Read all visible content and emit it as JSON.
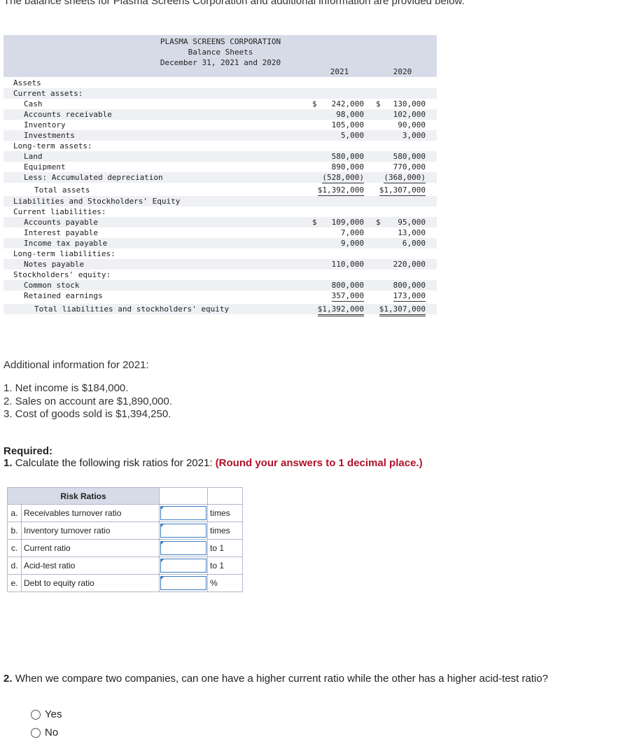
{
  "intro": "The balance sheets for Plasma Screens Corporation and additional information are provided below.",
  "balance_sheet": {
    "company": "PLASMA SCREENS CORPORATION",
    "statement": "Balance Sheets",
    "date": "December 31, 2021 and 2020",
    "years": [
      "2021",
      "2020"
    ],
    "rows": [
      {
        "label": "Assets",
        "indent": 0,
        "v1": "",
        "v2": ""
      },
      {
        "label": "Current assets:",
        "indent": 0,
        "v1": "",
        "v2": ""
      },
      {
        "label": "Cash",
        "indent": 2,
        "c1": "$",
        "v1": "242,000",
        "c2": "$",
        "v2": "130,000"
      },
      {
        "label": "Accounts receivable",
        "indent": 2,
        "v1": "98,000",
        "v2": "102,000"
      },
      {
        "label": "Inventory",
        "indent": 2,
        "v1": "105,000",
        "v2": "90,000"
      },
      {
        "label": "Investments",
        "indent": 2,
        "v1": "5,000",
        "v2": "3,000"
      },
      {
        "label": "Long-term assets:",
        "indent": 0,
        "v1": "",
        "v2": ""
      },
      {
        "label": "Land",
        "indent": 2,
        "v1": "580,000",
        "v2": "580,000"
      },
      {
        "label": "Equipment",
        "indent": 2,
        "v1": "890,000",
        "v2": "770,000"
      },
      {
        "label": "Less: Accumulated depreciation",
        "indent": 2,
        "v1": "(528,000)",
        "v2": "(368,000)",
        "line": "single"
      },
      {
        "label": "Total assets",
        "indent": 4,
        "v1": "$1,392,000",
        "v2": "$1,307,000",
        "line": "double"
      },
      {
        "label": "Liabilities and Stockholders' Equity",
        "indent": 0,
        "v1": "",
        "v2": ""
      },
      {
        "label": "Current liabilities:",
        "indent": 0,
        "v1": "",
        "v2": ""
      },
      {
        "label": "Accounts payable",
        "indent": 2,
        "c1": "$",
        "v1": "109,000",
        "c2": "$",
        "v2": "95,000"
      },
      {
        "label": "Interest payable",
        "indent": 2,
        "v1": "7,000",
        "v2": "13,000"
      },
      {
        "label": "Income tax payable",
        "indent": 2,
        "v1": "9,000",
        "v2": "6,000"
      },
      {
        "label": "Long-term liabilities:",
        "indent": 0,
        "v1": "",
        "v2": ""
      },
      {
        "label": "Notes payable",
        "indent": 2,
        "v1": "110,000",
        "v2": "220,000"
      },
      {
        "label": "Stockholders' equity:",
        "indent": 0,
        "v1": "",
        "v2": ""
      },
      {
        "label": "Common stock",
        "indent": 2,
        "v1": "800,000",
        "v2": "800,000"
      },
      {
        "label": "Retained earnings",
        "indent": 2,
        "v1": "357,000",
        "v2": "173,000",
        "line": "single"
      },
      {
        "label": "Total liabilities and stockholders' equity",
        "indent": 4,
        "v1": "$1,392,000",
        "v2": "$1,307,000",
        "line": "double"
      }
    ]
  },
  "additional": {
    "heading": "Additional information for 2021:",
    "items": [
      "1. Net income is $184,000.",
      "2. Sales on account are $1,890,000.",
      "3. Cost of goods sold is $1,394,250."
    ]
  },
  "required": {
    "heading": "Required:",
    "q1_num": "1.",
    "q1_text": "Calculate the following risk ratios for 2021:",
    "q1_note": "(Round your answers to 1 decimal place.)"
  },
  "risk_table": {
    "header": "Risk Ratios",
    "rows": [
      {
        "letter": "a.",
        "name": "Receivables turnover ratio",
        "value": "",
        "unit": "times"
      },
      {
        "letter": "b.",
        "name": "Inventory turnover ratio",
        "value": "",
        "unit": "times"
      },
      {
        "letter": "c.",
        "name": "Current ratio",
        "value": "",
        "unit": "to 1"
      },
      {
        "letter": "d.",
        "name": "Acid-test ratio",
        "value": "",
        "unit": "to 1"
      },
      {
        "letter": "e.",
        "name": "Debt to equity ratio",
        "value": "",
        "unit": "%"
      }
    ]
  },
  "question2": {
    "num": "2.",
    "text": "When we compare two companies, can one have a higher current ratio while the other has a higher acid-test ratio?",
    "options": [
      "Yes",
      "No"
    ]
  }
}
